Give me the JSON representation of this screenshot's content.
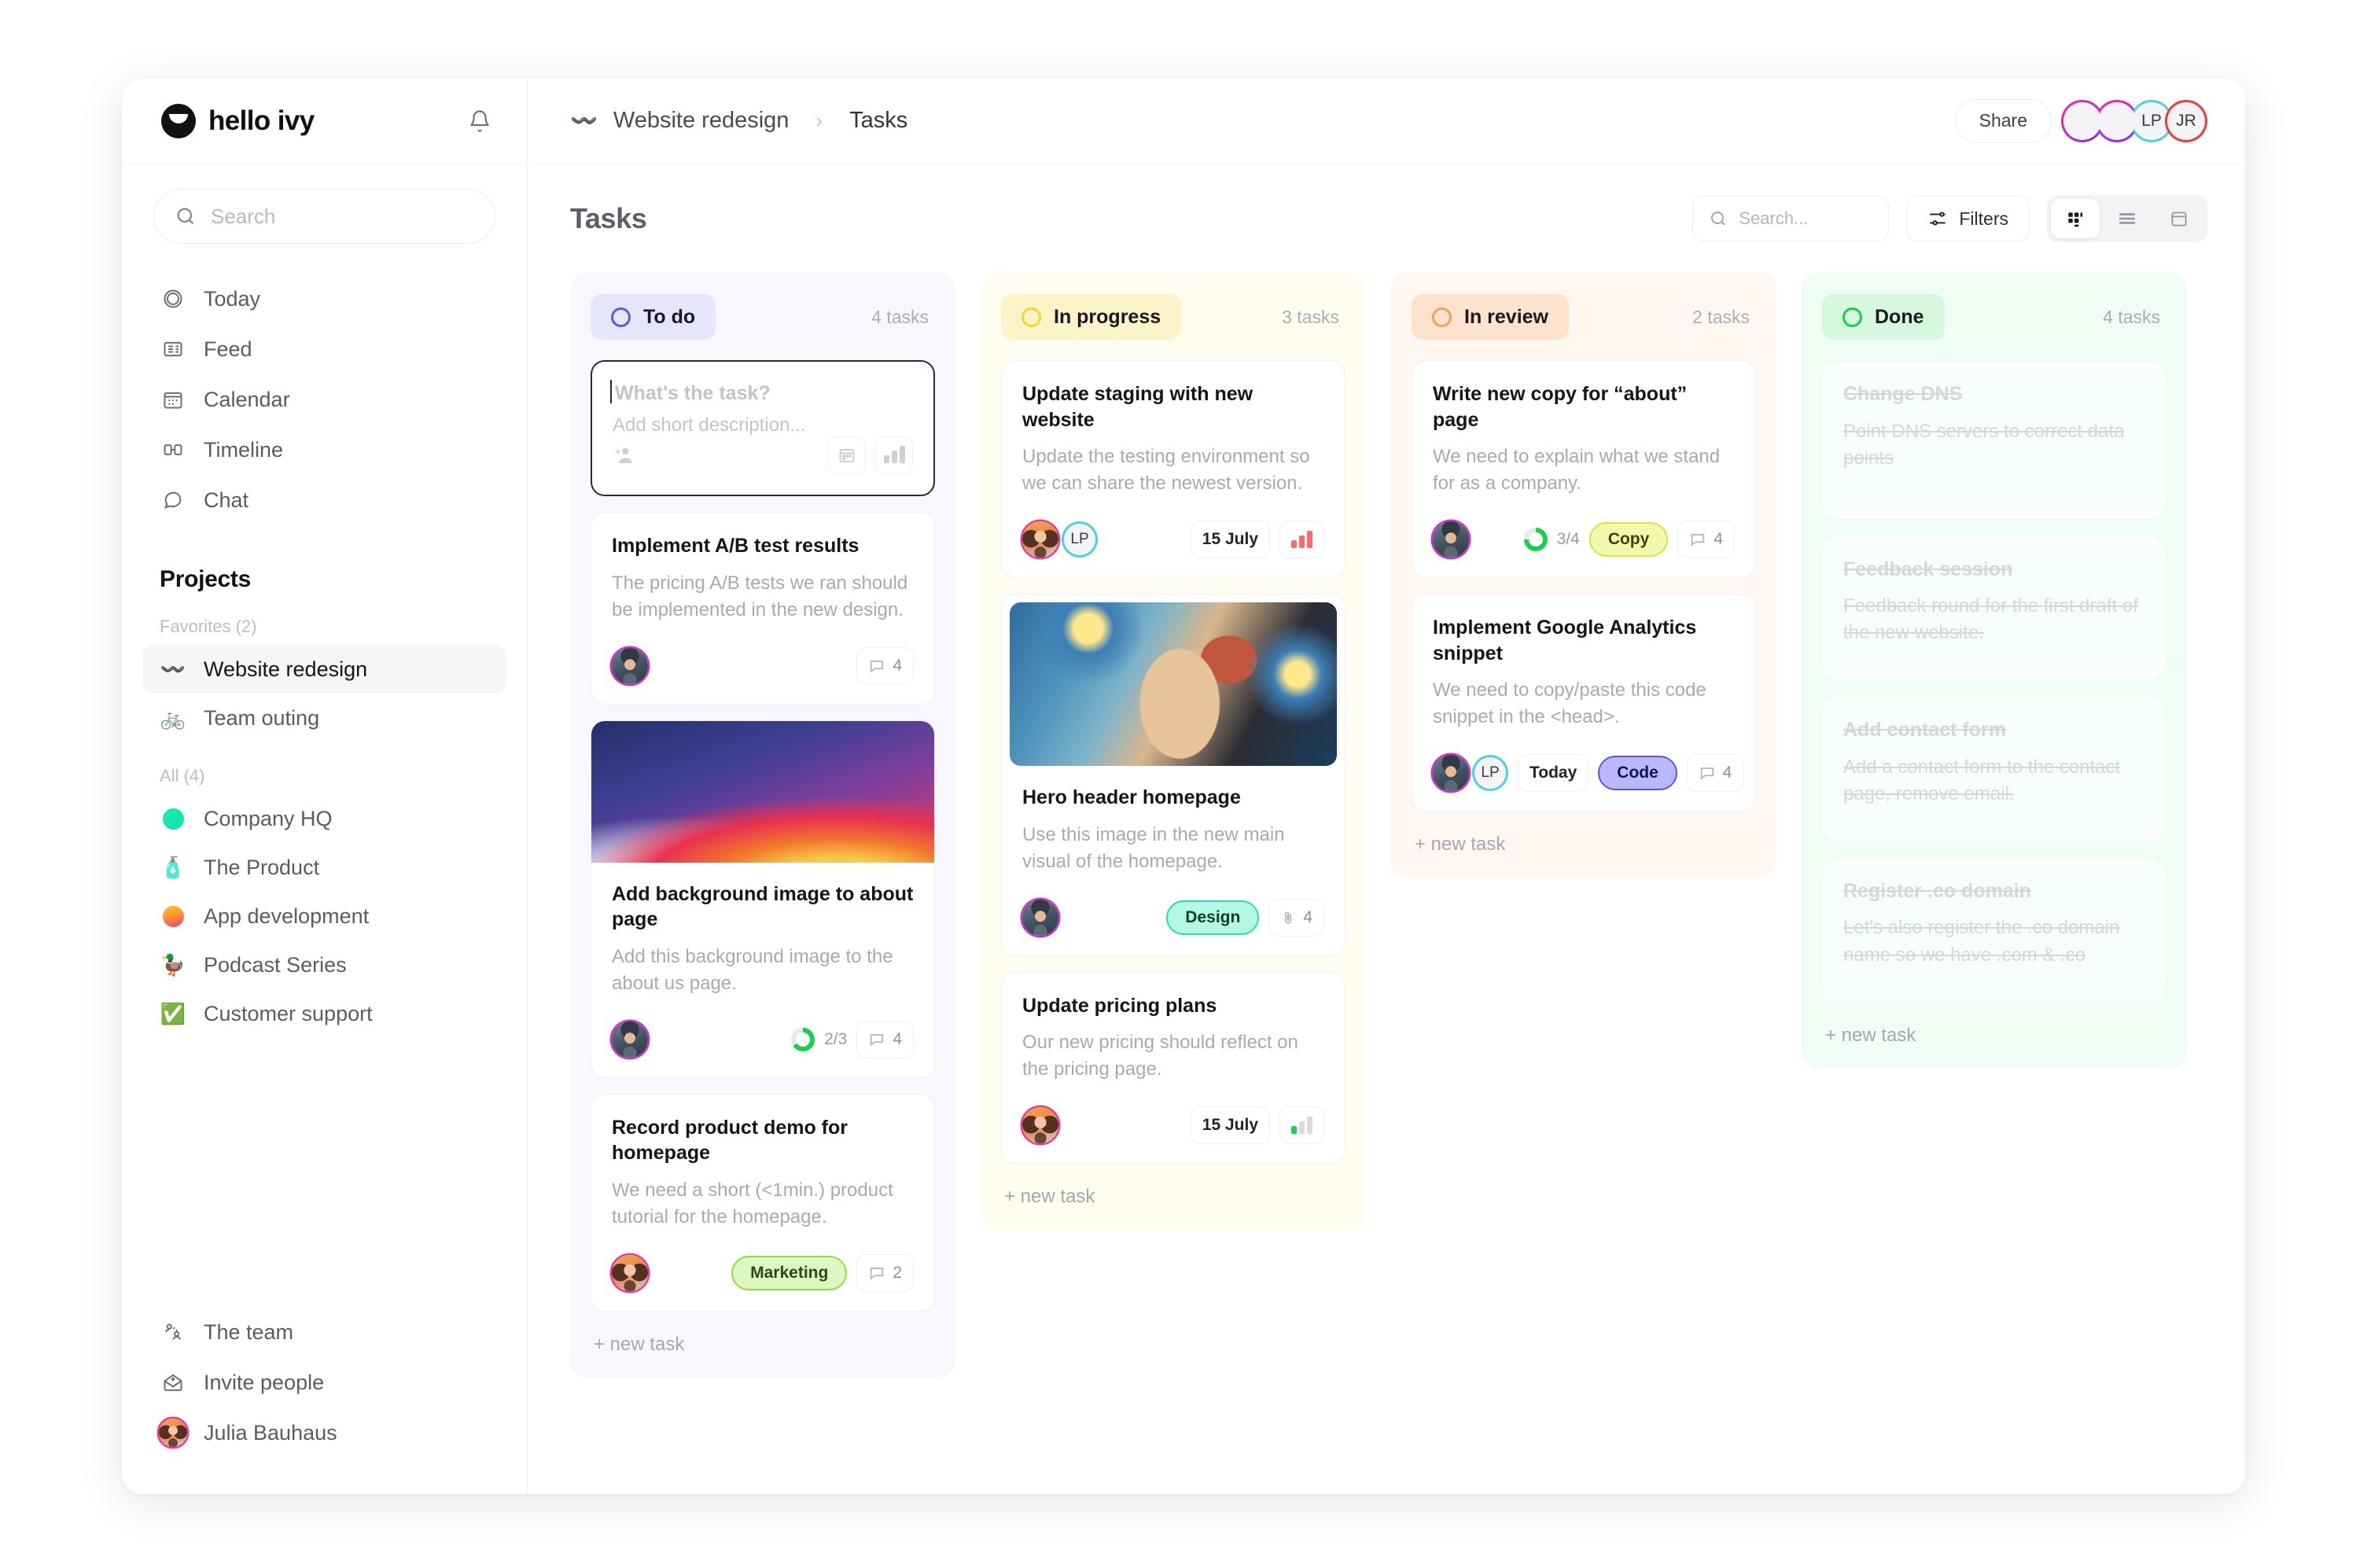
{
  "brand": {
    "name": "hello ivy",
    "logo_icon": "smiley-logo",
    "bell_icon": "bell-icon"
  },
  "sidebar": {
    "search": {
      "placeholder": "Search",
      "value": "",
      "icon": "search-icon"
    },
    "nav": [
      {
        "label": "Today",
        "icon": "circle-icon"
      },
      {
        "label": "Feed",
        "icon": "feed-icon"
      },
      {
        "label": "Calendar",
        "icon": "calendar-icon"
      },
      {
        "label": "Timeline",
        "icon": "timeline-icon"
      },
      {
        "label": "Chat",
        "icon": "chat-icon"
      }
    ],
    "projects_heading": "Projects",
    "favorites_label": "Favorites (2)",
    "favorites": [
      {
        "label": "Website redesign",
        "emoji": "〰️",
        "active": true
      },
      {
        "label": "Team outing",
        "emoji": "🚲",
        "active": false
      }
    ],
    "all_label": "All (4)",
    "all_projects": [
      {
        "label": "Company HQ",
        "icon": "teal-dot"
      },
      {
        "label": "The Product",
        "emoji": "🧴"
      },
      {
        "label": "App development",
        "icon": "gradient-dot"
      },
      {
        "label": "Podcast Series",
        "emoji": "🦆"
      },
      {
        "label": "Customer support",
        "emoji": "✅"
      }
    ],
    "footer": [
      {
        "label": "The team",
        "icon": "team-icon"
      },
      {
        "label": "Invite people",
        "icon": "envelope-plus-icon"
      },
      {
        "label": "Julia Bauhaus",
        "icon": "avatar"
      }
    ]
  },
  "header": {
    "breadcrumb": {
      "project_emoji": "〰️",
      "project": "Website redesign",
      "separator": "›",
      "current": "Tasks"
    },
    "share_label": "Share",
    "avatars": [
      {
        "type": "photo",
        "name": "julia",
        "ring": "#c22be0"
      },
      {
        "type": "photo",
        "name": "mark",
        "ring": "#c22be0"
      },
      {
        "type": "initials",
        "label": "LP",
        "ring": "#49d3e4"
      },
      {
        "type": "initials",
        "label": "JR",
        "ring": "#ef3c3c"
      }
    ]
  },
  "toolbar": {
    "page_title": "Tasks",
    "search": {
      "placeholder": "Search...",
      "value": "",
      "icon": "search-icon"
    },
    "filters_label": "Filters",
    "filters_icon": "sliders-icon",
    "views": [
      {
        "name": "board-view",
        "icon": "grid-icon",
        "active": true
      },
      {
        "name": "list-view",
        "icon": "list-icon",
        "active": false
      },
      {
        "name": "calendar-view",
        "icon": "panel-icon",
        "active": false
      }
    ]
  },
  "composer": {
    "title_placeholder": "What's the task?",
    "desc_placeholder": "Add short description...",
    "assign_icon": "add-person-icon",
    "date_icon": "calendar-icon",
    "priority_icon": "bars-icon"
  },
  "new_task_label": "+ new task",
  "columns": [
    {
      "id": "todo",
      "title": "To do",
      "count": "4 tasks",
      "cards": [
        {
          "title": "Implement A/B test results",
          "desc": "The pricing A/B tests we ran should be implemented in the new design.",
          "assignee": "mark",
          "comments": "4"
        },
        {
          "title": "Add background image to about page",
          "desc": "Add this background image to the about us page.",
          "assignee": "mark",
          "thumb": "macos-wallpaper",
          "progress": "2/3",
          "comments": "4"
        },
        {
          "title": "Record product demo for homepage",
          "desc": "We need a short (<1min.) product tutorial for the homepage.",
          "assignee": "julia",
          "tag": {
            "label": "Marketing",
            "color": "#8ee03c"
          },
          "comments": "2"
        }
      ]
    },
    {
      "id": "progress",
      "title": "In progress",
      "count": "3 tasks",
      "cards": [
        {
          "title": "Update staging with new website",
          "desc": "Update the testing environment so we can share the newest version.",
          "assignee": "julia",
          "assignee2": "LP",
          "date": "15 July",
          "priority": "high"
        },
        {
          "title": "Hero header homepage",
          "desc": "Use this image in the new main visual of the homepage.",
          "assignee": "mark",
          "thumb": "van-gogh-portrait",
          "tag": {
            "label": "Design",
            "color": "#26dfb0"
          },
          "attachments": "4"
        },
        {
          "title": "Update pricing plans",
          "desc": "Our new pricing should reflect on the pricing page.",
          "assignee": "julia",
          "date": "15 July",
          "priority": "low"
        }
      ]
    },
    {
      "id": "review",
      "title": "In review",
      "count": "2 tasks",
      "cards": [
        {
          "title": "Write new copy for “about” page",
          "desc": "We need to explain what we stand for as a company.",
          "assignee": "mark",
          "progress": "3/4",
          "tag": {
            "label": "Copy",
            "color": "#dbe23a"
          },
          "comments": "4"
        },
        {
          "title": "Implement Google Analytics snippet",
          "desc": "We need to copy/paste this code snippet in the <head>.",
          "assignee": "mark",
          "assignee2": "LP",
          "date": "Today",
          "tag": {
            "label": "Code",
            "color": "#5757ee"
          },
          "comments": "4"
        }
      ]
    },
    {
      "id": "done",
      "title": "Done",
      "count": "4 tasks",
      "cards": [
        {
          "title": "Change DNS",
          "desc": "Point DNS servers to correct data points"
        },
        {
          "title": "Feedback session",
          "desc": "Feedback round for the first draft of the new website."
        },
        {
          "title": "Add contact form",
          "desc": "Add a contact form to the contact page, remove email."
        },
        {
          "title": "Register .co domain",
          "desc": "Let's also register the .co domain name so we have .com & .co"
        }
      ]
    }
  ]
}
